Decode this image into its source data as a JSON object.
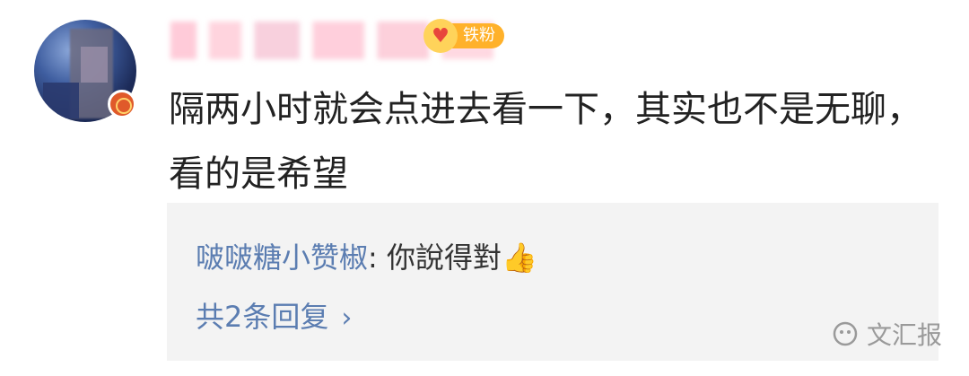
{
  "comment": {
    "fan_badge_label": "铁粉",
    "text": "隔两小时就会点进去看一下，其实也不是无聊，看的是希望"
  },
  "reply": {
    "user": "啵啵糖小赞椒",
    "separator": ": ",
    "text": "你說得對",
    "emoji": "👍",
    "count_label": "共2条回复",
    "chevron": "›"
  },
  "watermark": {
    "text": "文汇报",
    "icon": "wechat-official-account-icon"
  },
  "colors": {
    "link_blue": "#5b7db1",
    "reply_bg": "#f3f3f3",
    "badge_orange": "#ffb12a",
    "text_dark": "#222222"
  }
}
